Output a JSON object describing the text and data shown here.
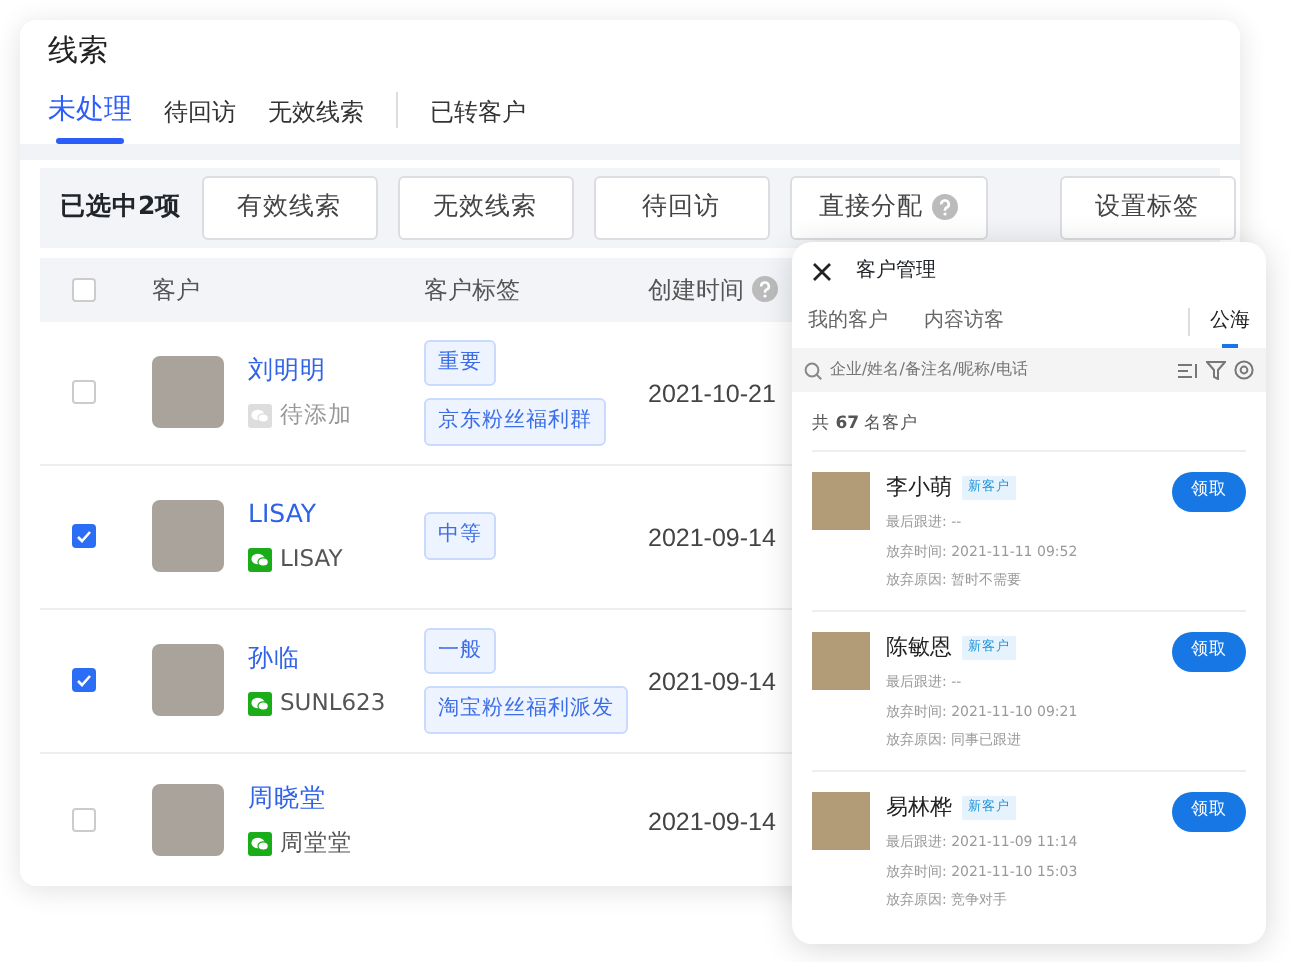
{
  "page_title": "线索",
  "tabs": [
    {
      "label": "未处理",
      "selected": true
    },
    {
      "label": "待回访",
      "selected": false
    },
    {
      "label": "无效线索",
      "selected": false
    },
    {
      "label": "已转客户",
      "selected": false,
      "kind": "separated"
    }
  ],
  "toolbar": {
    "selection": "已选中2项",
    "buttons": [
      {
        "label": "有效线索",
        "help": false
      },
      {
        "label": "无效线索",
        "help": false
      },
      {
        "label": "待回访",
        "help": false
      },
      {
        "label": "直接分配",
        "help": true
      },
      {
        "label": "设置标签",
        "help": false,
        "kind": "separated"
      }
    ]
  },
  "table": {
    "all_checked": false,
    "columns": [
      {
        "label": "客户",
        "help": false
      },
      {
        "label": "客户标签",
        "help": false
      },
      {
        "label": "创建时间",
        "help": true
      }
    ],
    "rows": [
      {
        "checked": false,
        "name": "刘明明",
        "wechat": "待添加",
        "wechat_added": false,
        "tags": [
          "重要",
          "京东粉丝福利群"
        ],
        "created": "2021-10-21"
      },
      {
        "checked": true,
        "name": "LISAY",
        "wechat": "LISAY",
        "wechat_added": true,
        "tags": [
          "中等"
        ],
        "created": "2021-09-14"
      },
      {
        "checked": true,
        "name": "孙临",
        "wechat": "SUNL623",
        "wechat_added": true,
        "tags": [
          "一般",
          "淘宝粉丝福利派发"
        ],
        "created": "2021-09-14"
      },
      {
        "checked": false,
        "name": "周晓堂",
        "wechat": "周堂堂",
        "wechat_added": true,
        "tags": [],
        "created": "2021-09-14"
      }
    ]
  },
  "panel": {
    "title": "客户管理",
    "tabs": [
      {
        "label": "我的客户",
        "selected": false
      },
      {
        "label": "内容访客",
        "selected": false
      },
      {
        "label": "公海",
        "selected": true
      }
    ],
    "search": {
      "placeholder": "企业/姓名/备注名/昵称/电话"
    },
    "count": "共 **67** 名客户",
    "customers": [
      {
        "name": "李小萌",
        "badge": "新客户",
        "lines": [
          "最后跟进: --",
          "放弃时间: 2021-11-11 09:52",
          "放弃原因: 暂时不需要"
        ],
        "action": "领取"
      },
      {
        "name": "陈敏恩",
        "badge": "新客户",
        "lines": [
          "最后跟进: --",
          "放弃时间: 2021-11-10 09:21",
          "放弃原因: 同事已跟进"
        ],
        "action": "领取"
      },
      {
        "name": "易林桦",
        "badge": "新客户",
        "lines": [
          "最后跟进: 2021-11-09 11:14",
          "放弃时间: 2021-11-10 15:03",
          "放弃原因: 竞争对手"
        ],
        "action": "领取"
      }
    ]
  }
}
